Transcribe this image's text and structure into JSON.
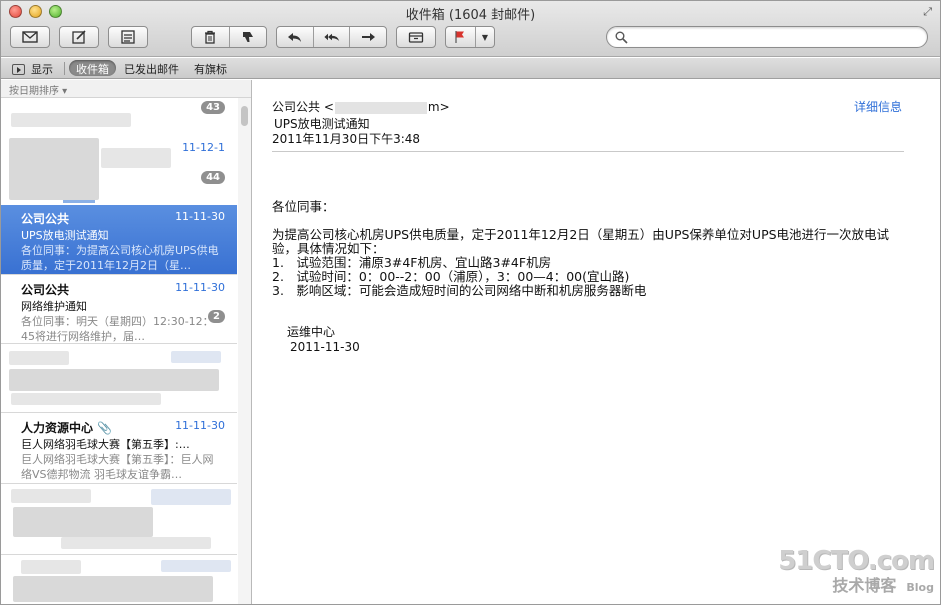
{
  "window": {
    "title": "收件箱 (1604 封邮件)"
  },
  "search": {
    "placeholder": "",
    "value": ""
  },
  "favorites": {
    "show_label": "显示",
    "items": [
      "收件箱",
      "已发出邮件",
      "有旗标"
    ],
    "active_index": 0
  },
  "list": {
    "sort_label": "按日期排序 ▾",
    "blurred_badges": [
      "43",
      "44"
    ],
    "blurred_date": "11-12-1",
    "messages": [
      {
        "from": "公司公共",
        "date": "11-11-30",
        "subject": "UPS放电测试通知",
        "preview": "各位同事：为提高公司核心机房UPS供电质量，定于2011年12月2日（星…",
        "selected": true
      },
      {
        "from": "公司公共",
        "date": "11-11-30",
        "subject": "网络维护通知",
        "preview": "各位同事：明天（星期四）12:30-12：45将进行网络维护，届…",
        "badge": "2",
        "selected": false
      },
      {
        "from": "人力资源中心",
        "date": "11-11-30",
        "subject": "巨人网络羽毛球大赛【第五季】:…",
        "preview": "巨人网络羽毛球大赛【第五季】：巨人网络VS德邦物流 羽毛球友谊争霸…",
        "selected": false
      }
    ]
  },
  "message": {
    "from_prefix": "公司公共 <",
    "from_suffix": "m>",
    "subject": "UPS放电测试通知",
    "date": "2011年11月30日下午3:48",
    "details_link": "详细信息",
    "greeting": "各位同事：",
    "body_lines": [
      "为提高公司核心机房UPS供电质量，定于2011年12月2日（星期五）由UPS保养单位对UPS电池进行一次放电试验，具体情况如下：",
      "1.　试验范围：浦原3#4F机房、宜山路3#4F机房",
      "2.　试验时间：0：00--2：00（浦原），3：00—4：00(宜山路)",
      "3.　影响区域：可能会造成短时间的公司网络中断和机房服务器断电"
    ],
    "signature_dept": "运维中心",
    "signature_date": "2011-11-30"
  },
  "watermark": {
    "main": "51CTO.com",
    "sub": "技术博客",
    "blog": "Blog"
  },
  "colors": {
    "selection": "#3971d2",
    "date_blue": "#2f6fd8",
    "link_blue": "#2f6fd8"
  },
  "icons": [
    "compose-mail-icon",
    "new-note-icon",
    "note-list-icon",
    "trash-icon",
    "junk-thumb-down-icon",
    "reply-icon",
    "reply-all-icon",
    "forward-icon",
    "archive-icon",
    "flag-icon",
    "search-icon",
    "attachment-icon"
  ]
}
